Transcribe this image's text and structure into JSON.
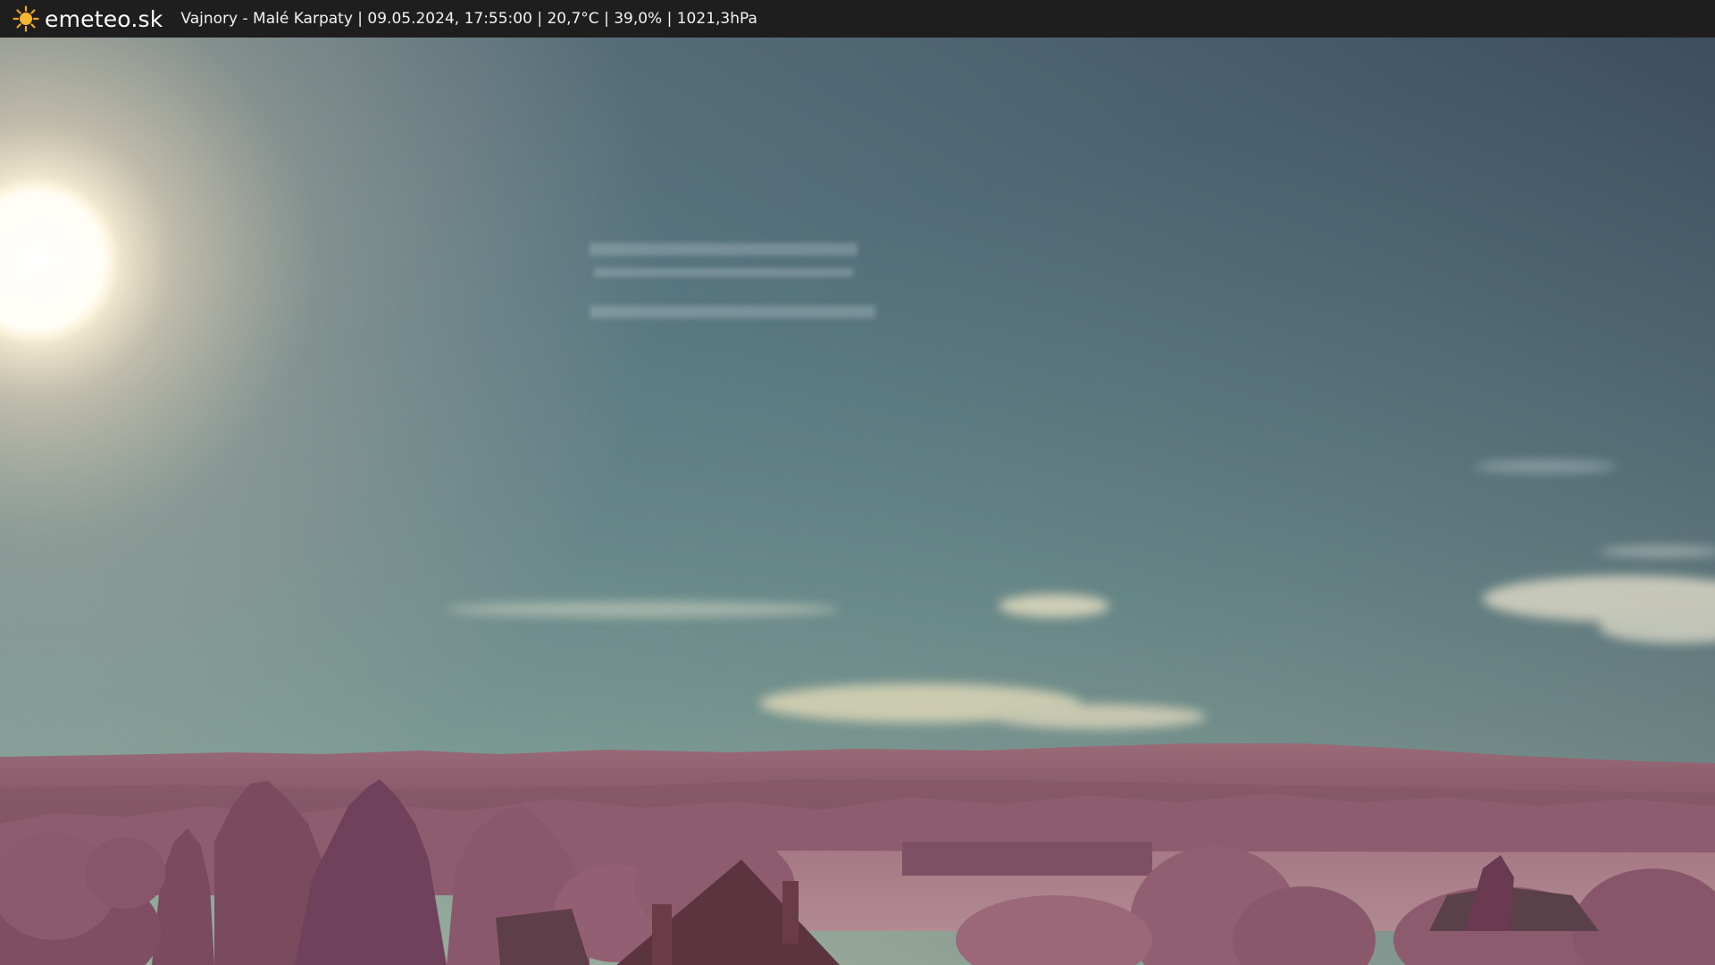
{
  "header": {
    "brand": "emeteo.sk",
    "caption": "Vajnory - Malé Karpaty | 09.05.2024, 17:55:00 | 20,7°C | 39,0% | 1021,3hPa",
    "logo_icon": "sun-icon"
  },
  "colors": {
    "header_bg": "#1e1e1e",
    "sun_icon": "#f5a623",
    "sky_top": "#3f5366",
    "sky_horizon": "#a7b7a4",
    "foliage": "#8a5a6e"
  }
}
